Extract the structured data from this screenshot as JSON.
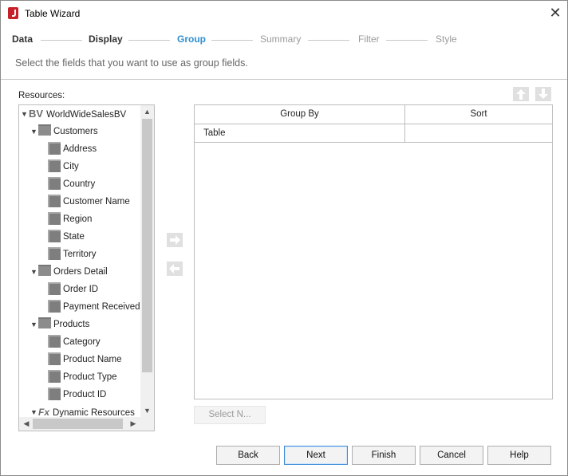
{
  "window": {
    "title": "Table Wizard",
    "close_label": "✕"
  },
  "steps": [
    {
      "label": "Data",
      "state": "done"
    },
    {
      "label": "Display",
      "state": "done"
    },
    {
      "label": "Group",
      "state": "active"
    },
    {
      "label": "Summary",
      "state": "pending"
    },
    {
      "label": "Filter",
      "state": "pending"
    },
    {
      "label": "Style",
      "state": "pending"
    }
  ],
  "instruction": "Select the fields that you want to use as group fields.",
  "resources": {
    "label": "Resources:",
    "tree": [
      {
        "label": "WorldWideSalesBV",
        "kind": "bv",
        "level": 0,
        "expanded": true
      },
      {
        "label": "Customers",
        "kind": "folder",
        "level": 1,
        "expanded": true
      },
      {
        "label": "Address",
        "kind": "field",
        "level": 2
      },
      {
        "label": "City",
        "kind": "field",
        "level": 2
      },
      {
        "label": "Country",
        "kind": "field",
        "level": 2
      },
      {
        "label": "Customer Name",
        "kind": "field",
        "level": 2
      },
      {
        "label": "Region",
        "kind": "field",
        "level": 2
      },
      {
        "label": "State",
        "kind": "field",
        "level": 2
      },
      {
        "label": "Territory",
        "kind": "field",
        "level": 2
      },
      {
        "label": "Orders Detail",
        "kind": "folder",
        "level": 1,
        "expanded": true
      },
      {
        "label": "Order ID",
        "kind": "field",
        "level": 2
      },
      {
        "label": "Payment Received",
        "kind": "field",
        "level": 2
      },
      {
        "label": "Products",
        "kind": "folder",
        "level": 1,
        "expanded": true
      },
      {
        "label": "Category",
        "kind": "field",
        "level": 2
      },
      {
        "label": "Product Name",
        "kind": "field",
        "level": 2
      },
      {
        "label": "Product Type",
        "kind": "field",
        "level": 2
      },
      {
        "label": "Product ID",
        "kind": "field",
        "level": 2
      },
      {
        "label": "Dynamic Resources",
        "kind": "fx",
        "level": 1,
        "expanded": true
      }
    ]
  },
  "icons": {
    "add": "arrow-right-icon",
    "remove": "arrow-left-icon",
    "move_up": "arrow-up-icon",
    "move_down": "arrow-down-icon"
  },
  "group_table": {
    "headers": [
      "Group By",
      "Sort"
    ],
    "rows": [
      {
        "group_by": "Table",
        "sort": ""
      }
    ]
  },
  "select_button": "Select N...",
  "buttons": {
    "back": "Back",
    "next": "Next",
    "finish": "Finish",
    "cancel": "Cancel",
    "help": "Help"
  },
  "colors": {
    "active_step": "#2f8fd0",
    "disabled_icon": "#e0e0e0",
    "primary_border": "#3c8dd9"
  }
}
